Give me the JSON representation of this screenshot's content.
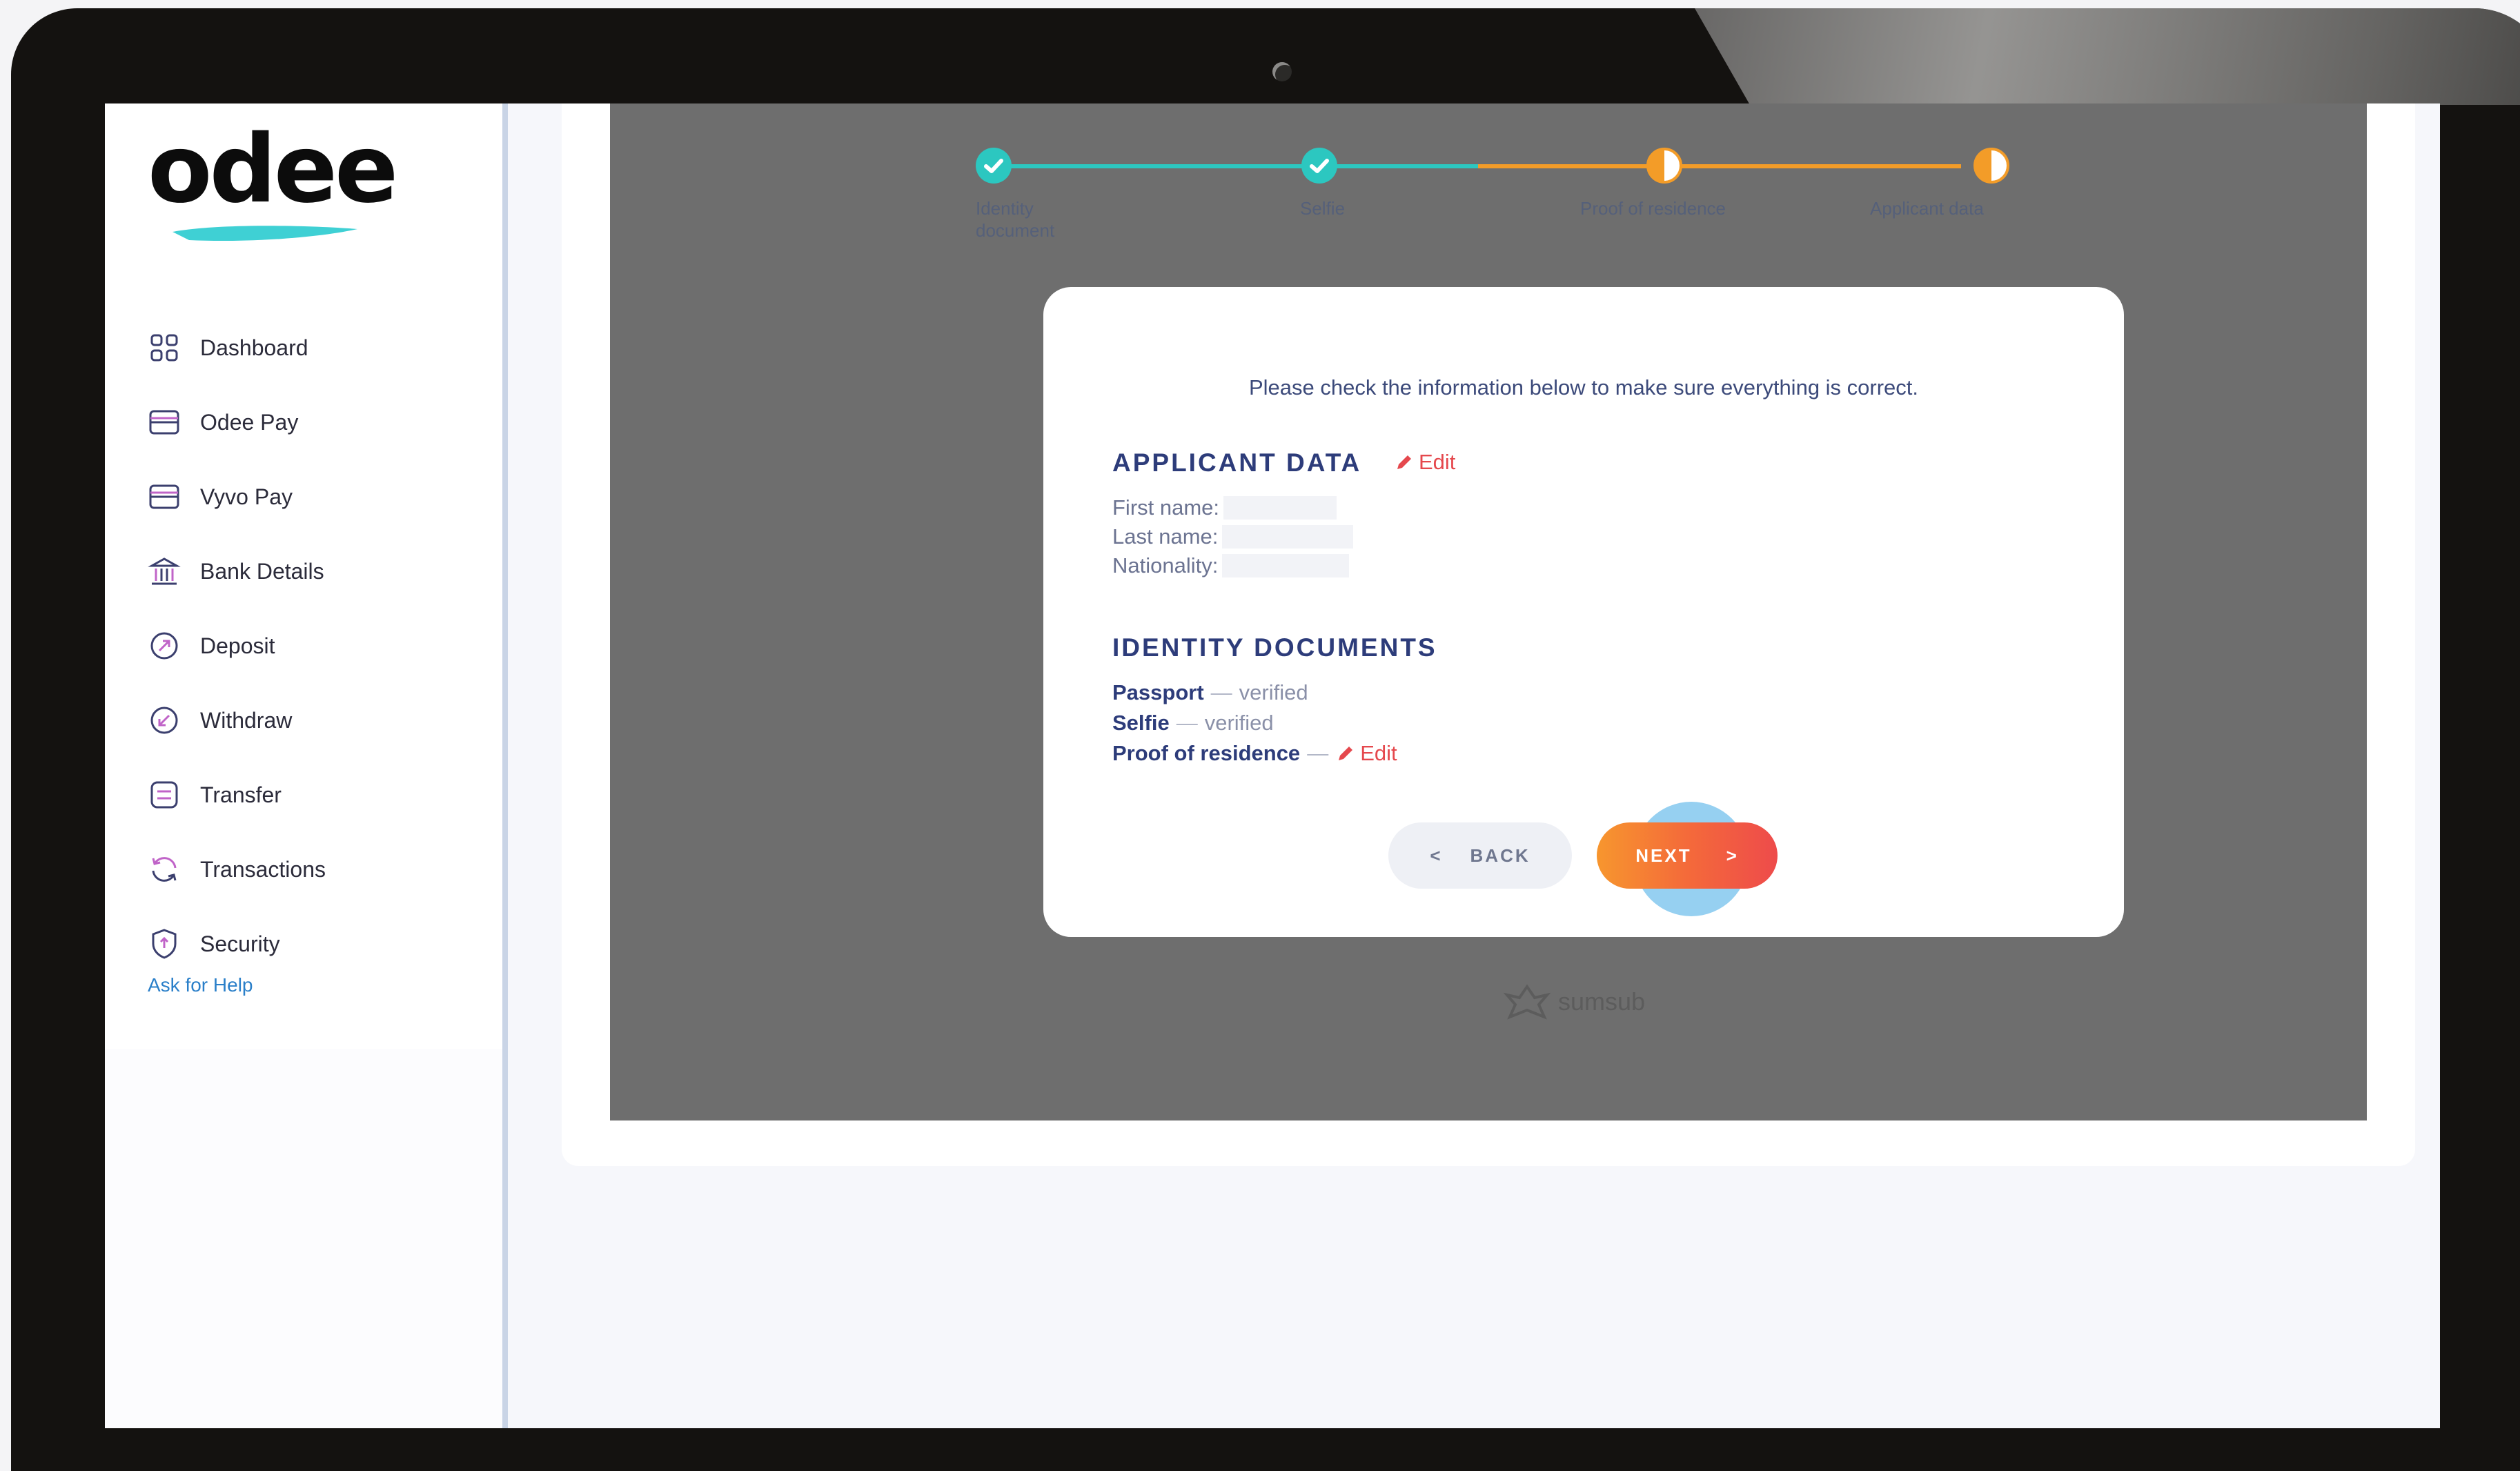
{
  "brand": {
    "logo_text": "odee",
    "accent_color": "#2cc7c0"
  },
  "sidebar": {
    "items": [
      {
        "label": "Dashboard",
        "icon": "grid-icon"
      },
      {
        "label": "Odee Pay",
        "icon": "card-icon"
      },
      {
        "label": "Vyvo Pay",
        "icon": "card-icon"
      },
      {
        "label": "Bank Details",
        "icon": "bank-icon"
      },
      {
        "label": "Deposit",
        "icon": "deposit-icon"
      },
      {
        "label": "Withdraw",
        "icon": "withdraw-icon"
      },
      {
        "label": "Transfer",
        "icon": "transfer-icon"
      },
      {
        "label": "Transactions",
        "icon": "refresh-icon"
      },
      {
        "label": "Security",
        "icon": "shield-icon"
      }
    ],
    "help_link": "Ask for Help"
  },
  "stepper": {
    "steps": [
      {
        "label_line1": "Identity",
        "label_line2": "document",
        "status": "done"
      },
      {
        "label_line1": "Selfie",
        "label_line2": "",
        "status": "done"
      },
      {
        "label_line1": "Proof of residence",
        "label_line2": "",
        "status": "in-progress"
      },
      {
        "label_line1": "Applicant data",
        "label_line2": "",
        "status": "in-progress"
      }
    ]
  },
  "modal": {
    "intro": "Please check the information below to make sure everything is correct.",
    "applicant": {
      "title": "APPLICANT DATA",
      "edit_label": "Edit",
      "fields": [
        {
          "label": "First name:",
          "value": ""
        },
        {
          "label": "Last name:",
          "value": ""
        },
        {
          "label": "Nationality:",
          "value": ""
        }
      ]
    },
    "documents": {
      "title": "IDENTITY DOCUMENTS",
      "items": [
        {
          "name": "Passport",
          "status": "verified"
        },
        {
          "name": "Selfie",
          "status": "verified"
        },
        {
          "name": "Proof of residence",
          "status": ""
        }
      ],
      "edit_label": "Edit"
    },
    "back_label": "BACK",
    "next_label": "NEXT",
    "back_chevron": "<",
    "next_chevron": ">"
  },
  "footer_brand": "sumsub",
  "colors": {
    "orange": "#f39c28",
    "teal": "#2cc7c0",
    "red": "#e5484d",
    "navy": "#2d3c7a"
  }
}
